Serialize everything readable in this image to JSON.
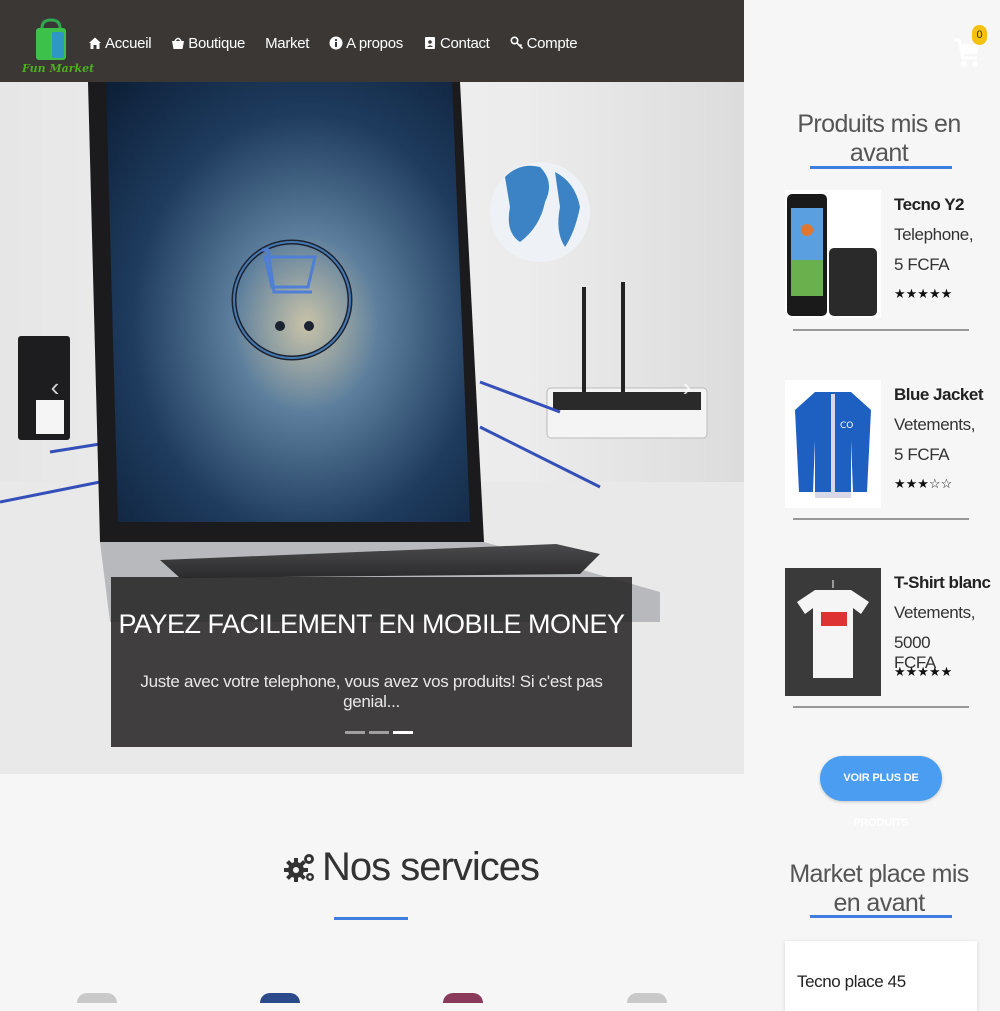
{
  "brand": {
    "name": "Fun Market"
  },
  "nav": {
    "items": [
      {
        "label": "Accueil",
        "icon": "home-icon"
      },
      {
        "label": "Boutique",
        "icon": "basket-icon"
      },
      {
        "label": "Market",
        "icon": ""
      },
      {
        "label": "A propos",
        "icon": "info-icon"
      },
      {
        "label": "Contact",
        "icon": "contact-card-icon"
      },
      {
        "label": "Compte",
        "icon": "key-icon"
      }
    ],
    "cart_count": "0"
  },
  "hero": {
    "title": "PAYEZ FACILEMENT EN MOBILE MONEY",
    "subtitle": "Juste avec votre telephone, vous avez vos produits! Si c'est pas genial...",
    "slides": 3,
    "active_slide": 3
  },
  "featured": {
    "title": "Produits mis en avant",
    "products": [
      {
        "name": "Tecno Y2",
        "category": "Telephone,",
        "price": "5 FCFA",
        "stars": "★★★★★",
        "rating": 5
      },
      {
        "name": "Blue Jacket",
        "category": "Vetements,",
        "price": "5 FCFA",
        "stars": "★★★☆☆",
        "rating": 3
      },
      {
        "name": "T-Shirt blanc",
        "category": "Vetements,",
        "price": "5000 FCFA",
        "stars": "★★★★★",
        "rating": 5
      }
    ],
    "more_button": "VOIR PLUS DE PRODUITS"
  },
  "services": {
    "title": "Nos services"
  },
  "marketplace": {
    "title": "Market place mis en avant",
    "items": [
      {
        "name": "Tecno place 45"
      }
    ]
  },
  "colors": {
    "navbar": "#3a3735",
    "accent_blue": "#3e7ee0",
    "button_blue": "#4a9df0",
    "badge": "#f4c10f",
    "logo_green": "#4caf1e"
  }
}
